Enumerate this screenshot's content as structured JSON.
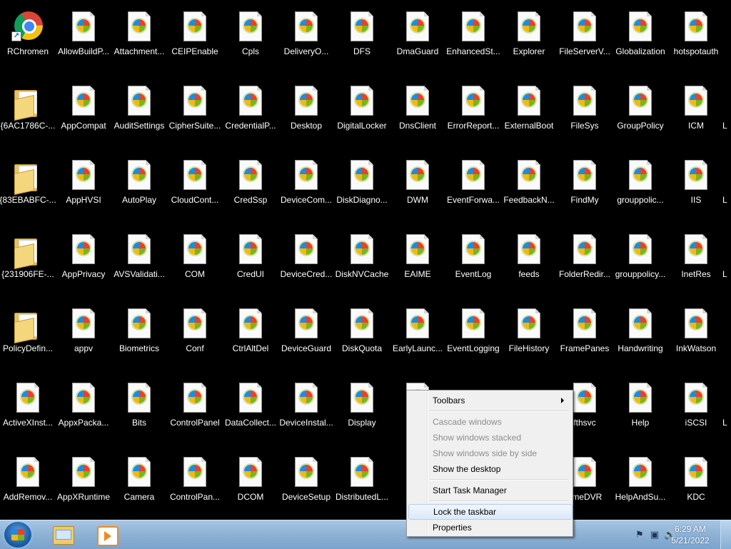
{
  "desktop": {
    "columns": [
      [
        "RChromen",
        "{6AC1786C-...",
        "{83EBABFC-...",
        "{231906FE-...",
        "PolicyDefin...",
        "ActiveXInst...",
        "AddRemov..."
      ],
      [
        "AllowBuildP...",
        "AppCompat",
        "AppHVSI",
        "AppPrivacy",
        "appv",
        "AppxPacka...",
        "AppXRuntime"
      ],
      [
        "Attachment...",
        "AuditSettings",
        "AutoPlay",
        "AVSValidati...",
        "Biometrics",
        "Bits",
        "Camera"
      ],
      [
        "CEIPEnable",
        "CipherSuite...",
        "CloudCont...",
        "COM",
        "Conf",
        "ControlPanel",
        "ControlPan..."
      ],
      [
        "Cpls",
        "CredentialP...",
        "CredSsp",
        "CredUI",
        "CtrlAltDel",
        "DataCollect...",
        "DCOM"
      ],
      [
        "DeliveryO...",
        "Desktop",
        "DeviceCom...",
        "DeviceCred...",
        "DeviceGuard",
        "DeviceInstal...",
        "DeviceSetup"
      ],
      [
        "DFS",
        "DigitalLocker",
        "DiskDiagno...",
        "DiskNVCache",
        "DiskQuota",
        "Display",
        "DistributedL..."
      ],
      [
        "DmaGuard",
        "DnsClient",
        "DWM",
        "EAIME",
        "EarlyLaunc...",
        "E",
        "Enc"
      ],
      [
        "EnhancedSt...",
        "ErrorReport...",
        "EventForwa...",
        "EventLog",
        "EventLogging",
        "",
        ""
      ],
      [
        "Explorer",
        "ExternalBoot",
        "FeedbackN...",
        "feeds",
        "FileHistory",
        "",
        ""
      ],
      [
        "FileServerV...",
        "FileSys",
        "FindMy",
        "FolderRedir...",
        "FramePanes",
        "fthsvc",
        "ameDVR"
      ],
      [
        "Globalization",
        "GroupPolicy",
        "grouppolic...",
        "grouppolicy...",
        "Handwriting",
        "Help",
        "HelpAndSu..."
      ],
      [
        "hotspotauth",
        "ICM",
        "IIS",
        "InetRes",
        "InkWatson",
        "iSCSI",
        "KDC"
      ],
      [
        "",
        "L",
        "L",
        "L",
        "",
        "L",
        ""
      ]
    ],
    "icon_types": {
      "chrome": [
        "0,0"
      ],
      "folder": [
        "0,1",
        "0,2",
        "0,3",
        "0,4"
      ]
    }
  },
  "context_menu": {
    "items": [
      {
        "label": "Toolbars",
        "enabled": true,
        "submenu": true
      },
      {
        "separator": true
      },
      {
        "label": "Cascade windows",
        "enabled": false
      },
      {
        "label": "Show windows stacked",
        "enabled": false
      },
      {
        "label": "Show windows side by side",
        "enabled": false
      },
      {
        "label": "Show the desktop",
        "enabled": true
      },
      {
        "separator": true
      },
      {
        "label": "Start Task Manager",
        "enabled": true
      },
      {
        "separator": true
      },
      {
        "label": "Lock the taskbar",
        "enabled": true,
        "hover": true
      },
      {
        "label": "Properties",
        "enabled": true
      }
    ]
  },
  "taskbar": {
    "pinned": [
      {
        "name": "windows-explorer",
        "icon": "folder-icon"
      },
      {
        "name": "media-player",
        "icon": "media-player-icon"
      }
    ],
    "tray_icons": [
      "action-center-flag-icon",
      "network-icon",
      "volume-icon"
    ],
    "clock": {
      "time": "6:29 AM",
      "date": "5/21/2022"
    }
  },
  "colors": {
    "desktop_bg": "#000000",
    "taskbar": "#8fb3d6",
    "menu_bg": "#f0f0f0",
    "menu_disabled_text": "#8d8d8d",
    "menu_hover_border": "#aecff7"
  }
}
